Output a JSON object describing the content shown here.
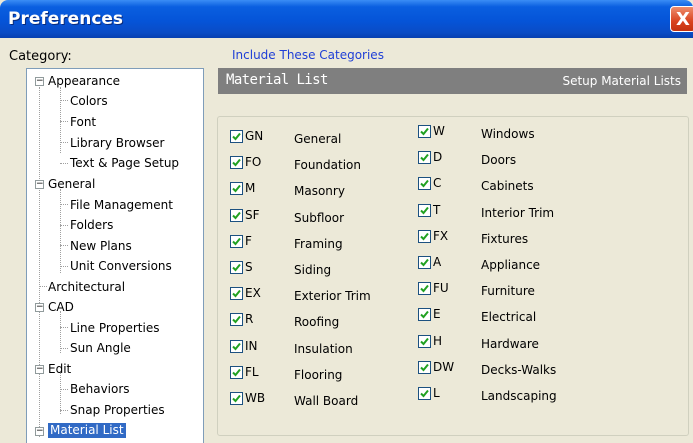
{
  "window": {
    "title": "Preferences",
    "close_glyph": "X"
  },
  "category_label": "Category:",
  "tree": {
    "appearance": "Appearance",
    "colors": "Colors",
    "font": "Font",
    "library_browser": "Library Browser",
    "text_page_setup": "Text & Page Setup",
    "general": "General",
    "file_management": "File Management",
    "folders": "Folders",
    "new_plans": "New Plans",
    "unit_conversions": "Unit Conversions",
    "architectural": "Architectural",
    "cad": "CAD",
    "line_properties": "Line Properties",
    "sun_angle": "Sun Angle",
    "edit": "Edit",
    "behaviors": "Behaviors",
    "snap_properties": "Snap Properties",
    "material_list": "Material List",
    "expanded_glyph": "−"
  },
  "panel": {
    "title": "Material List",
    "subtitle": "Setup Material Lists",
    "group_label": "Include These Categories"
  },
  "categories_left": [
    {
      "code": "GN",
      "name": "General",
      "checked": true
    },
    {
      "code": "FO",
      "name": "Foundation",
      "checked": true
    },
    {
      "code": "M",
      "name": "Masonry",
      "checked": true
    },
    {
      "code": "SF",
      "name": "Subfloor",
      "checked": true
    },
    {
      "code": "F",
      "name": "Framing",
      "checked": true
    },
    {
      "code": "S",
      "name": "Siding",
      "checked": true
    },
    {
      "code": "EX",
      "name": "Exterior Trim",
      "checked": true
    },
    {
      "code": "R",
      "name": "Roofing",
      "checked": true
    },
    {
      "code": "IN",
      "name": "Insulation",
      "checked": true
    },
    {
      "code": "FL",
      "name": "Flooring",
      "checked": true
    },
    {
      "code": "WB",
      "name": "Wall Board",
      "checked": true
    }
  ],
  "categories_right": [
    {
      "code": "W",
      "name": "Windows",
      "checked": true
    },
    {
      "code": "D",
      "name": "Doors",
      "checked": true
    },
    {
      "code": "C",
      "name": "Cabinets",
      "checked": true
    },
    {
      "code": "T",
      "name": "Interior Trim",
      "checked": true
    },
    {
      "code": "FX",
      "name": "Fixtures",
      "checked": true
    },
    {
      "code": "A",
      "name": "Appliance",
      "checked": true
    },
    {
      "code": "FU",
      "name": "Furniture",
      "checked": true
    },
    {
      "code": "E",
      "name": "Electrical",
      "checked": true
    },
    {
      "code": "H",
      "name": "Hardware",
      "checked": true
    },
    {
      "code": "DW",
      "name": "Decks-Walks",
      "checked": true
    },
    {
      "code": "L",
      "name": "Landscaping",
      "checked": true
    }
  ],
  "colors": {
    "checkmark": "#21A121",
    "title_bar": "#0554D8",
    "selection": "#316AC5",
    "group_label": "#1F3FD6"
  }
}
